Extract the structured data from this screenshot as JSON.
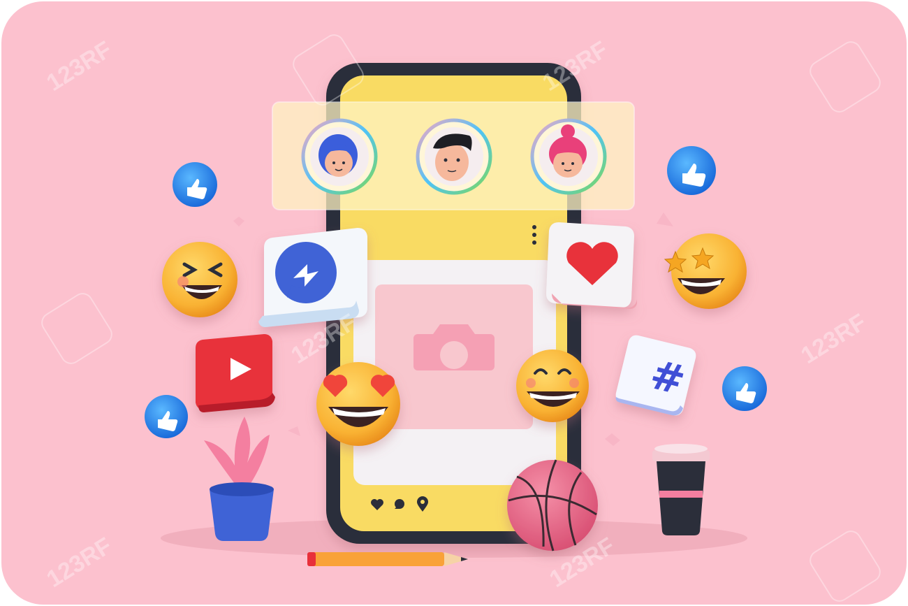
{
  "scene": {
    "background_color": "#FCC1CE",
    "phone_body_color": "#2B2E3A",
    "phone_screen_color": "#F9DB64",
    "card_color": "#F4F1F4",
    "photo_placeholder_color": "#F8C7CE",
    "accent_blue": "#1E88F0",
    "accent_red": "#E8303A",
    "emoji_yellow": "#F9B233"
  },
  "stories": [
    {
      "name": "girl-avatar-blue-hair",
      "ring_color": "#4FC3F7"
    },
    {
      "name": "boy-avatar-black-hair",
      "ring_color": "#7ED957"
    },
    {
      "name": "girl-avatar-pink-hair",
      "ring_color": "#F6A6C1"
    }
  ],
  "post_actions": [
    "heart-icon",
    "comment-icon",
    "location-pin-icon"
  ],
  "hashtag_symbol": "#",
  "watermark": "123RF"
}
